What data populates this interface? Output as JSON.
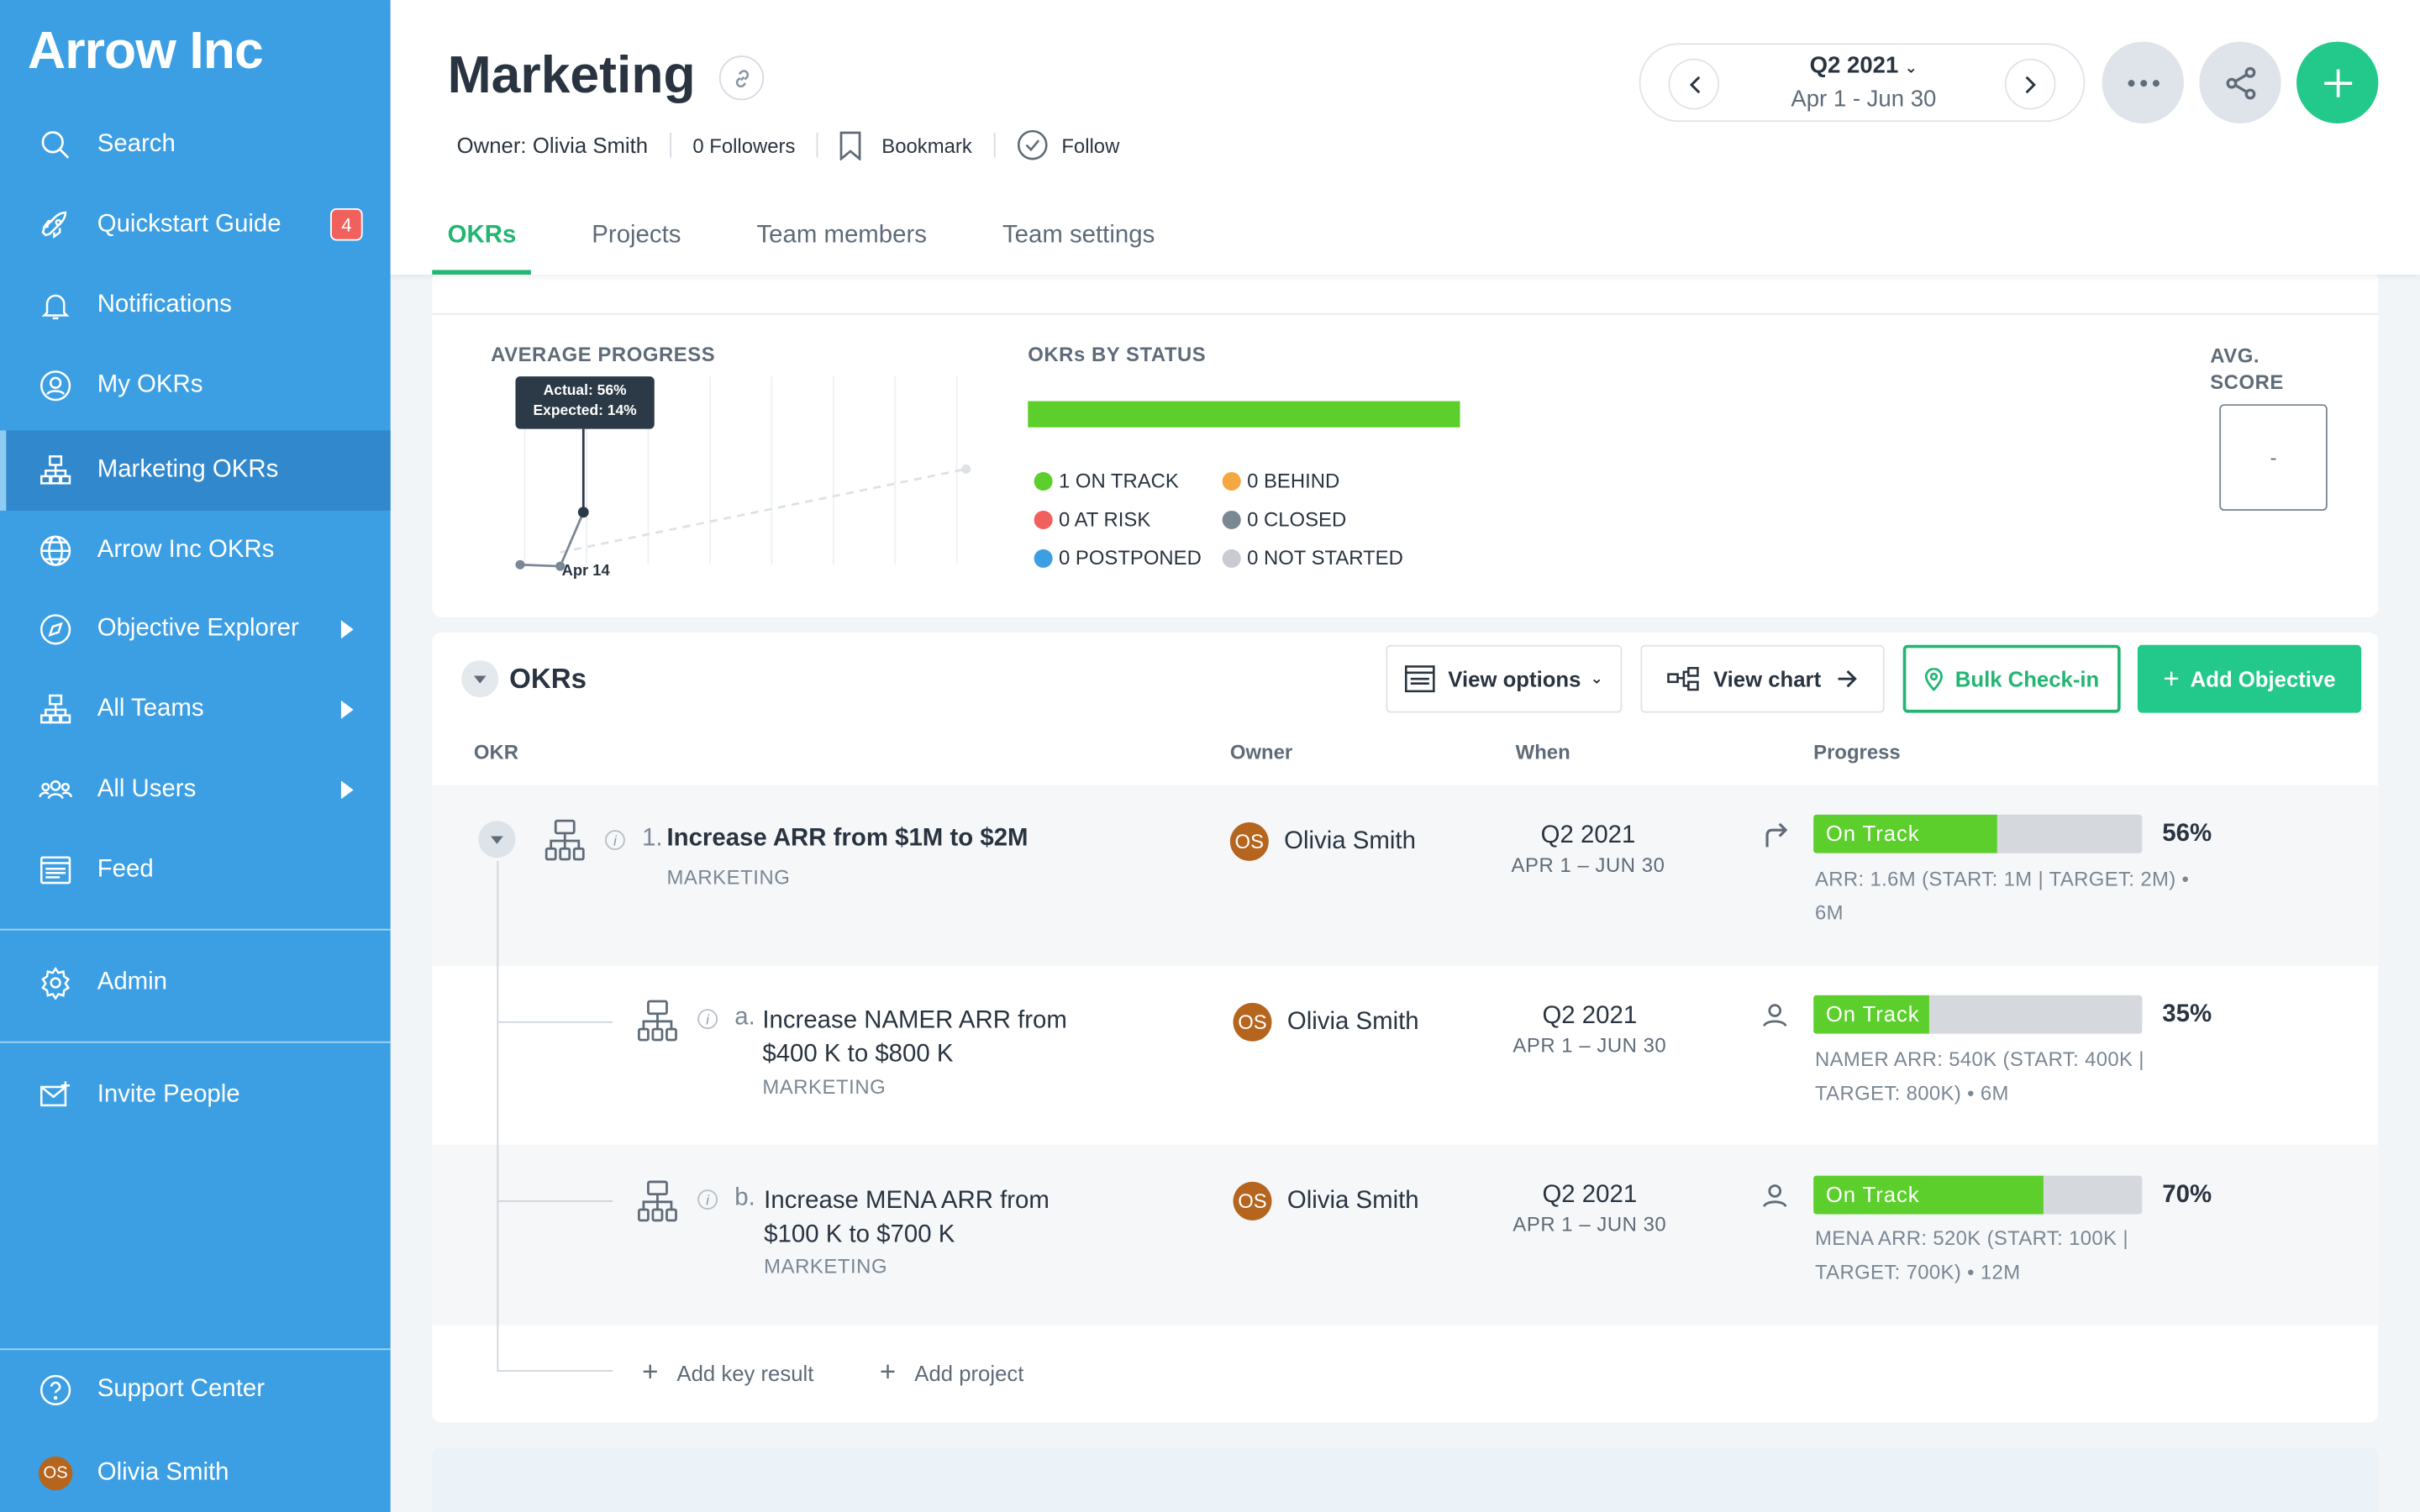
{
  "sidebar": {
    "brand": "Arrow Inc",
    "items": [
      {
        "label": "Search",
        "icon": "search-icon"
      },
      {
        "label": "Quickstart Guide",
        "icon": "rocket-icon",
        "badge": "4"
      },
      {
        "label": "Notifications",
        "icon": "bell-icon"
      },
      {
        "label": "My OKRs",
        "icon": "user-circle-icon"
      },
      {
        "label": "Marketing OKRs",
        "icon": "org-chart-icon",
        "active": true
      },
      {
        "label": "Arrow Inc OKRs",
        "icon": "globe-icon"
      },
      {
        "label": "Objective Explorer",
        "icon": "compass-icon"
      },
      {
        "label": "All Teams",
        "icon": "org-chart-icon"
      },
      {
        "label": "All Users",
        "icon": "users-icon"
      },
      {
        "label": "Feed",
        "icon": "feed-icon"
      }
    ],
    "admin": "Admin",
    "invite": "Invite People",
    "support": "Support Center",
    "user": {
      "name": "Olivia Smith",
      "initials": "OS"
    }
  },
  "header": {
    "title": "Marketing",
    "owner_label": "Owner:",
    "owner_name": "Olivia Smith",
    "followers": "0 Followers",
    "bookmark": "Bookmark",
    "follow": "Follow",
    "period": {
      "quarter": "Q2 2021",
      "range": "Apr 1 - Jun 30"
    },
    "tabs": [
      "OKRs",
      "Projects",
      "Team members",
      "Team settings"
    ]
  },
  "summary": {
    "avg_progress_label": "AVERAGE PROGRESS",
    "tooltip_actual": "Actual: 56%",
    "tooltip_expected": "Expected: 14%",
    "date_label": "Apr 14",
    "status_label": "OKRs BY STATUS",
    "avg_score_label": "AVG. SCORE",
    "avg_score_value": "-",
    "statuses": [
      {
        "label": "1 ON TRACK",
        "color": "#5ccf2c"
      },
      {
        "label": "0 BEHIND",
        "color": "#f5a742"
      },
      {
        "label": "0 AT RISK",
        "color": "#f0605c"
      },
      {
        "label": "0 CLOSED",
        "color": "#7b8794"
      },
      {
        "label": "0 POSTPONED",
        "color": "#3d9fe3"
      },
      {
        "label": "0 NOT STARTED",
        "color": "#c8ccd0"
      }
    ]
  },
  "okrs": {
    "section_title": "OKRs",
    "view_options": "View options",
    "view_chart": "View chart",
    "bulk_checkin": "Bulk Check-in",
    "add_objective": "Add Objective",
    "columns": {
      "okr": "OKR",
      "owner": "Owner",
      "when": "When",
      "progress": "Progress"
    },
    "rows": [
      {
        "index": "1.",
        "title": "Increase ARR from $1M to $2M",
        "team": "MARKETING",
        "owner": "Olivia Smith",
        "initials": "OS",
        "quarter": "Q2 2021",
        "range": "APR 1 – JUN 30",
        "status": "On Track",
        "progress": 0.56,
        "pct": "56%",
        "desc1": "ARR: 1.6M (START: 1M | TARGET: 2M) •",
        "desc2": "6M"
      },
      {
        "index": "a.",
        "title1": "Increase NAMER ARR from",
        "title2": "$400 K to $800 K",
        "team": "MARKETING",
        "owner": "Olivia Smith",
        "initials": "OS",
        "quarter": "Q2 2021",
        "range": "APR 1 – JUN 30",
        "status": "On Track",
        "progress": 0.35,
        "pct": "35%",
        "desc1": "NAMER ARR: 540K (START: 400K |",
        "desc2": "TARGET: 800K) • 6M"
      },
      {
        "index": "b.",
        "title1": "Increase MENA ARR from",
        "title2": "$100 K to $700 K",
        "team": "MARKETING",
        "owner": "Olivia Smith",
        "initials": "OS",
        "quarter": "Q2 2021",
        "range": "APR 1 – JUN 30",
        "status": "On Track",
        "progress": 0.7,
        "pct": "70%",
        "desc1": "MENA ARR: 520K (START: 100K |",
        "desc2": "TARGET: 700K) • 12M"
      }
    ],
    "add_key_result": "Add key result",
    "add_project": "Add project"
  },
  "colors": {
    "sidebar": "#3d9fe3",
    "accent": "#22b573",
    "on_track": "#5ccf2c"
  }
}
